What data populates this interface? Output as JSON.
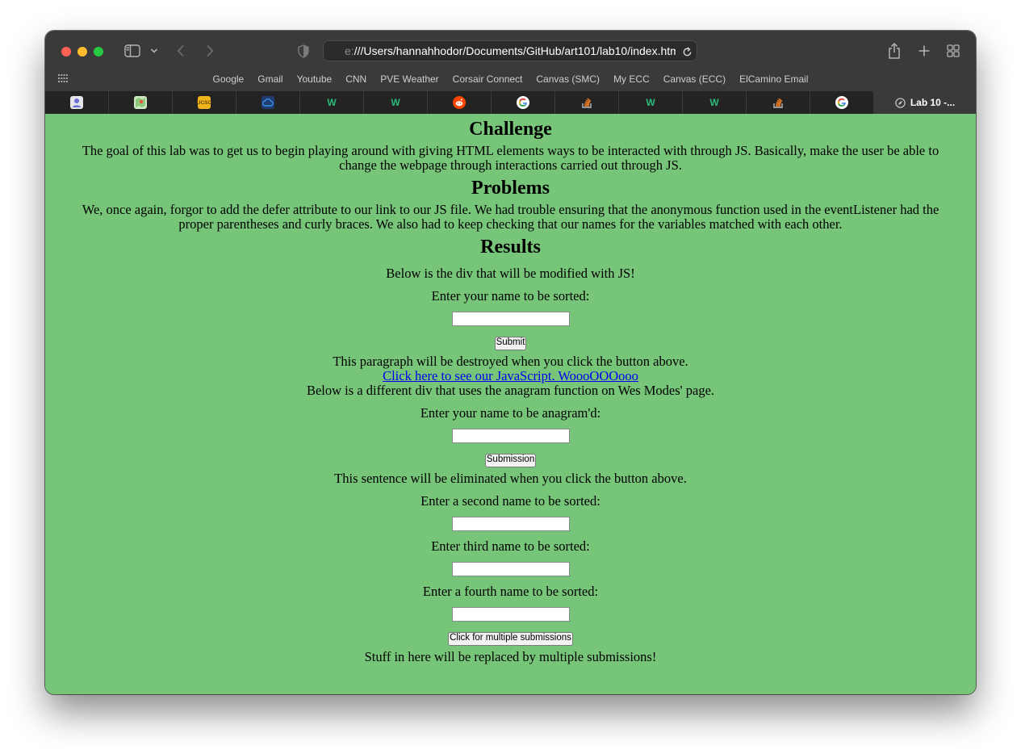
{
  "browser": {
    "url_prefix": "e:",
    "url": "///Users/hannahhodor/Documents/GitHub/art101/lab10/index.html",
    "favorites": [
      "Google",
      "Gmail",
      "Youtube",
      "CNN",
      "PVE Weather",
      "Corsair Connect",
      "Canvas (SMC)",
      "My ECC",
      "Canvas (ECC)",
      "ElCamino Email"
    ],
    "tabs": [
      {
        "icon": "profile-icon"
      },
      {
        "icon": "maps-icon"
      },
      {
        "icon": "ucsc-icon"
      },
      {
        "icon": "cloud-icon"
      },
      {
        "icon": "w-icon"
      },
      {
        "icon": "w-icon"
      },
      {
        "icon": "reddit-icon"
      },
      {
        "icon": "google-icon"
      },
      {
        "icon": "stackoverflow-icon"
      },
      {
        "icon": "w-icon"
      },
      {
        "icon": "w-icon"
      },
      {
        "icon": "stackoverflow-icon"
      },
      {
        "icon": "google-icon"
      }
    ],
    "active_tab_title": "Lab 10 -..."
  },
  "page": {
    "challenge_heading": "Challenge",
    "challenge_text": "The goal of this lab was to get us to begin playing around with giving HTML elements ways to be interacted with through JS. Basically, make the user be able to change the webpage through interactions carried out through JS.",
    "problems_heading": "Problems",
    "problems_text": "We, once again, forgor to add the defer attribute to our link to our JS file. We had trouble ensuring that the anonymous function used in the eventListener had the proper parentheses and curly braces. We also had to keep checking that our names for the variables matched with each other.",
    "results_heading": "Results",
    "div_intro": "Below is the div that will be modified with JS!",
    "name_prompt": "Enter your name to be sorted:",
    "submit_label": "Submit",
    "destroy_text": "This paragraph will be destroyed when you click the button above.",
    "js_link": "Click here to see our JavaScript. WoooOOOooo",
    "anagram_intro": "Below is a different div that uses the anagram function on Wes Modes' page.",
    "anagram_prompt": "Enter your name to be anagram'd:",
    "submission_label": "Submission",
    "eliminate_text": "This sentence will be eliminated when you click the button above.",
    "second_prompt": "Enter a second name to be sorted:",
    "third_prompt": "Enter third name to be sorted:",
    "fourth_prompt": "Enter a fourth name to be sorted:",
    "multi_label": "Click for multiple submissions",
    "replace_text": "Stuff in here will be replaced by multiple submissions!"
  },
  "colors": {
    "page_bg": "#77c579",
    "toolbar_bg": "#3a3a3b",
    "link": "#0000ee"
  }
}
